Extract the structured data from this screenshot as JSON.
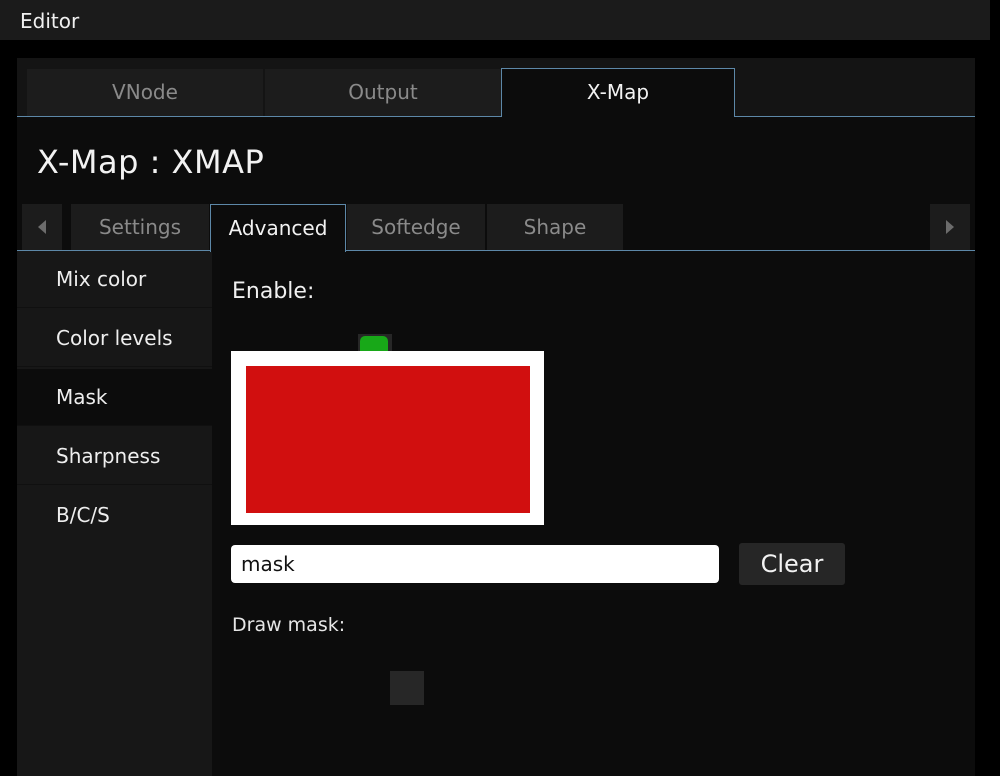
{
  "window": {
    "title": "Editor"
  },
  "top_tabs": [
    {
      "label": "VNode",
      "active": false
    },
    {
      "label": "Output",
      "active": false
    },
    {
      "label": "X-Map",
      "active": true
    }
  ],
  "panel": {
    "title": "X-Map : XMAP"
  },
  "sub_tabs": [
    {
      "label": "Settings",
      "active": false
    },
    {
      "label": "Advanced",
      "active": true
    },
    {
      "label": "Softedge",
      "active": false
    },
    {
      "label": "Shape",
      "active": false
    }
  ],
  "scroll_buttons": {
    "left_icon": "chevron-left-icon",
    "right_icon": "chevron-right-icon"
  },
  "sidebar": {
    "items": [
      {
        "label": "Mix color",
        "selected": false
      },
      {
        "label": "Color levels",
        "selected": false
      },
      {
        "label": "Mask",
        "selected": true
      },
      {
        "label": "Sharpness",
        "selected": false
      },
      {
        "label": "B/C/S",
        "selected": false
      }
    ]
  },
  "mask": {
    "enable_label": "Enable:",
    "enabled": true,
    "preview_color": "#d10f0f",
    "input_value": "mask",
    "clear_label": "Clear",
    "draw_label": "Draw mask:",
    "draw_enabled": false
  },
  "colors": {
    "accent_line": "#5d88a8",
    "enable_green": "#18a818"
  }
}
